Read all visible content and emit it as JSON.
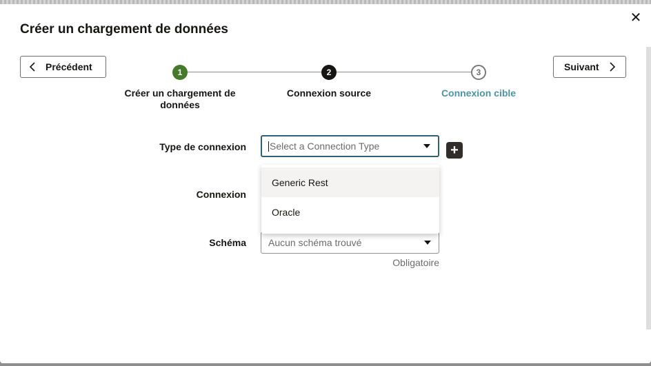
{
  "dialog": {
    "title": "Créer un chargement de données",
    "close_symbol": "✕"
  },
  "nav": {
    "prev_label": "Précédent",
    "next_label": "Suivant"
  },
  "steps": [
    {
      "number": "1",
      "label": "Créer un chargement de données",
      "state": "completed"
    },
    {
      "number": "2",
      "label": "Connexion source",
      "state": "current"
    },
    {
      "number": "3",
      "label": "Connexion cible",
      "state": "upcoming"
    }
  ],
  "form": {
    "connection_type": {
      "label": "Type de connexion",
      "placeholder": "Select a Connection Type",
      "options": [
        "Generic Rest",
        "Oracle"
      ]
    },
    "connection": {
      "label": "Connexion"
    },
    "schema": {
      "label": "Schéma",
      "value": "Aucun schéma trouvé",
      "helper": "Obligatoire"
    },
    "add_symbol": "+"
  },
  "colors": {
    "step_completed": "#457a2a",
    "step_current": "#161513",
    "step_upcoming_label": "#4a95a3",
    "focus_border": "#2f5f74"
  }
}
